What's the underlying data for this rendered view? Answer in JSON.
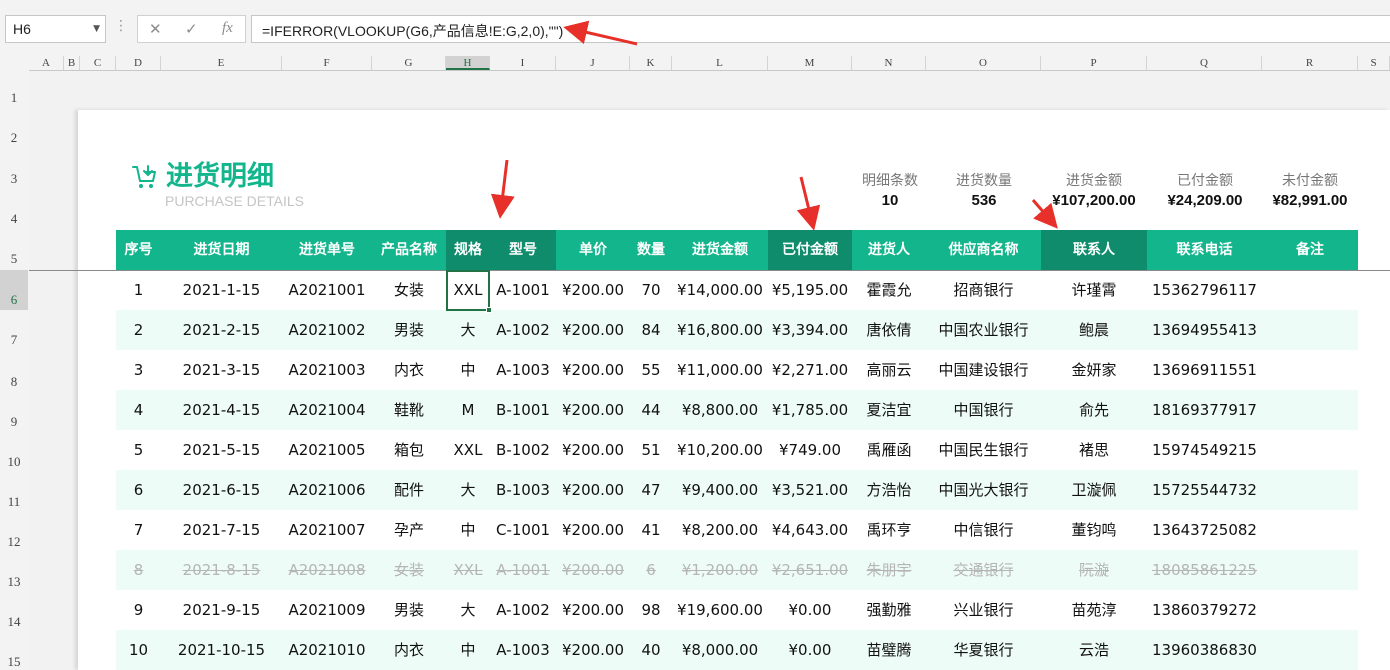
{
  "formula_bar": {
    "name_box": "H6",
    "cancel_icon": "✕",
    "enter_icon": "✓",
    "fx_label": "fx",
    "formula": "=IFERROR(VLOOKUP(G6,产品信息!E:G,2,0),\"\")"
  },
  "columns": [
    "A",
    "B",
    "C",
    "D",
    "E",
    "F",
    "G",
    "H",
    "I",
    "J",
    "K",
    "L",
    "M",
    "N",
    "O",
    "P",
    "Q",
    "R",
    "S"
  ],
  "row_numbers": [
    "1",
    "2",
    "3",
    "4",
    "5",
    "6",
    "7",
    "8",
    "9",
    "10",
    "11",
    "12",
    "13",
    "14",
    "15"
  ],
  "header": {
    "title": "进货明细",
    "subtitle": "PURCHASE DETAILS",
    "icon": "cart-plus-icon"
  },
  "summary": [
    {
      "label": "明细条数",
      "value": "10"
    },
    {
      "label": "进货数量",
      "value": "536"
    },
    {
      "label": "进货金额",
      "value": "¥107,200.00"
    },
    {
      "label": "已付金额",
      "value": "¥24,209.00"
    },
    {
      "label": "未付金额",
      "value": "¥82,991.00"
    }
  ],
  "table": {
    "headers": [
      "序号",
      "进货日期",
      "进货单号",
      "产品名称",
      "规格",
      "型号",
      "单价",
      "数量",
      "进货金额",
      "已付金额",
      "进货人",
      "供应商名称",
      "联系人",
      "联系电话",
      "备注"
    ],
    "rows": [
      [
        "1",
        "2021-1-15",
        "A2021001",
        "女装",
        "XXL",
        "A-1001",
        "¥200.00",
        "70",
        "¥14,000.00",
        "¥5,195.00",
        "霍霞允",
        "招商银行",
        "许瑾霄",
        "15362796117",
        ""
      ],
      [
        "2",
        "2021-2-15",
        "A2021002",
        "男装",
        "大",
        "A-1002",
        "¥200.00",
        "84",
        "¥16,800.00",
        "¥3,394.00",
        "唐依倩",
        "中国农业银行",
        "鲍晨",
        "13694955413",
        ""
      ],
      [
        "3",
        "2021-3-15",
        "A2021003",
        "内衣",
        "中",
        "A-1003",
        "¥200.00",
        "55",
        "¥11,000.00",
        "¥2,271.00",
        "高丽云",
        "中国建设银行",
        "金妍家",
        "13696911551",
        ""
      ],
      [
        "4",
        "2021-4-15",
        "A2021004",
        "鞋靴",
        "M",
        "B-1001",
        "¥200.00",
        "44",
        "¥8,800.00",
        "¥1,785.00",
        "夏洁宜",
        "中国银行",
        "俞先",
        "18169377917",
        ""
      ],
      [
        "5",
        "2021-5-15",
        "A2021005",
        "箱包",
        "XXL",
        "B-1002",
        "¥200.00",
        "51",
        "¥10,200.00",
        "¥749.00",
        "禹雁函",
        "中国民生银行",
        "褚思",
        "15974549215",
        ""
      ],
      [
        "6",
        "2021-6-15",
        "A2021006",
        "配件",
        "大",
        "B-1003",
        "¥200.00",
        "47",
        "¥9,400.00",
        "¥3,521.00",
        "方浩怡",
        "中国光大银行",
        "卫漩佩",
        "15725544732",
        ""
      ],
      [
        "7",
        "2021-7-15",
        "A2021007",
        "孕产",
        "中",
        "C-1001",
        "¥200.00",
        "41",
        "¥8,200.00",
        "¥4,643.00",
        "禹环亨",
        "中信银行",
        "董钧鸣",
        "13643725082",
        ""
      ],
      [
        "8",
        "2021-8-15",
        "A2021008",
        "女装",
        "XXL",
        "A-1001",
        "¥200.00",
        "6",
        "¥1,200.00",
        "¥2,651.00",
        "朱朋宇",
        "交通银行",
        "阮漩",
        "18085861225",
        ""
      ],
      [
        "9",
        "2021-9-15",
        "A2021009",
        "男装",
        "大",
        "A-1002",
        "¥200.00",
        "98",
        "¥19,600.00",
        "¥0.00",
        "强勤雅",
        "兴业银行",
        "苗苑淳",
        "13860379272",
        ""
      ],
      [
        "10",
        "2021-10-15",
        "A2021010",
        "内衣",
        "中",
        "A-1003",
        "¥200.00",
        "40",
        "¥8,000.00",
        "¥0.00",
        "苗璧腾",
        "华夏银行",
        "云浩",
        "13960386830",
        ""
      ]
    ]
  },
  "colors": {
    "accent": "#13b58c",
    "accent_dark": "#0e8c6c",
    "stripe": "#eefcf8",
    "annotation_arrow": "#e8302a"
  }
}
